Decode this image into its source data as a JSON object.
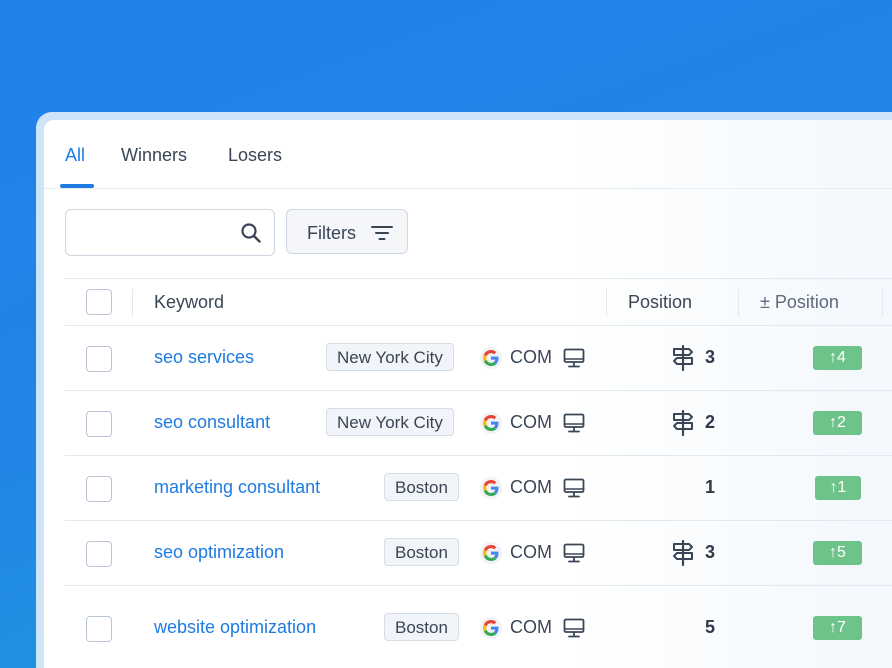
{
  "tabs": [
    {
      "label": "All",
      "active": true
    },
    {
      "label": "Winners",
      "active": false
    },
    {
      "label": "Losers",
      "active": false
    }
  ],
  "search": {
    "placeholder": "",
    "value": ""
  },
  "filters": {
    "label": "Filters"
  },
  "table": {
    "headers": {
      "keyword": "Keyword",
      "position": "Position",
      "change": "± Position"
    },
    "rows": [
      {
        "keyword": "seo services",
        "location": "New York City",
        "engine": "google-icon",
        "domain": "COM",
        "device": "desktop-icon",
        "has_sign_icon": true,
        "position": "3",
        "change": "↑4"
      },
      {
        "keyword": "seo consultant",
        "location": "New York City",
        "engine": "google-icon",
        "domain": "COM",
        "device": "desktop-icon",
        "has_sign_icon": true,
        "position": "2",
        "change": "↑2"
      },
      {
        "keyword": "marketing consultant",
        "location": "Boston",
        "engine": "google-icon",
        "domain": "COM",
        "device": "desktop-icon",
        "has_sign_icon": false,
        "position": "1",
        "change": "↑1"
      },
      {
        "keyword": "seo optimization",
        "location": "Boston",
        "engine": "google-icon",
        "domain": "COM",
        "device": "desktop-icon",
        "has_sign_icon": true,
        "position": "3",
        "change": "↑5"
      },
      {
        "keyword": "website optimization",
        "location": "Boston",
        "engine": "google-icon",
        "domain": "COM",
        "device": "desktop-icon",
        "has_sign_icon": false,
        "position": "5",
        "change": "↑7"
      }
    ]
  },
  "colors": {
    "accent": "#1e7be0",
    "badge_green": "#6cc48a",
    "text": "#3a4556"
  }
}
